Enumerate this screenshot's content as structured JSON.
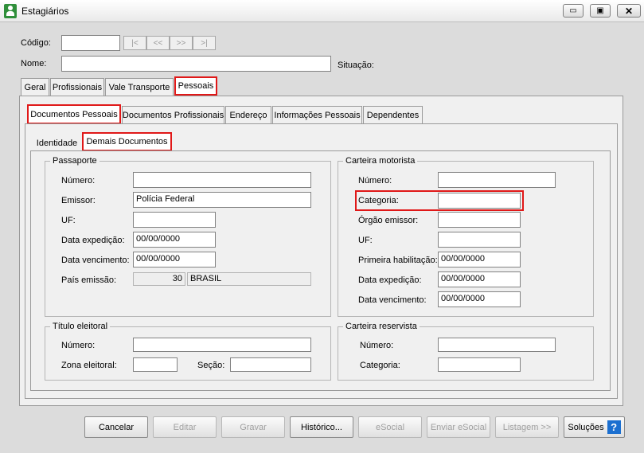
{
  "window": {
    "title": "Estagiários",
    "minimize": "▭",
    "maximize": "▣",
    "close": "✕"
  },
  "header": {
    "codigo_label": "Código:",
    "codigo_value": "",
    "nav": [
      "|<",
      "<<",
      ">>",
      ">|"
    ],
    "nome_label": "Nome:",
    "nome_value": "",
    "situacao_label": "Situação:"
  },
  "main_tabs": [
    "Geral",
    "Profissionais",
    "Vale Transporte",
    "Pessoais"
  ],
  "sub_tabs": [
    "Documentos Pessoais",
    "Documentos Profissionais",
    "Endereço",
    "Informações Pessoais",
    "Dependentes"
  ],
  "doc_tabs": [
    "Identidade",
    "Demais Documentos"
  ],
  "passaporte": {
    "legend": "Passaporte",
    "numero_label": "Número:",
    "numero": "",
    "emissor_label": "Emissor:",
    "emissor": "Polícia Federal",
    "uf_label": "UF:",
    "uf": "",
    "expedicao_label": "Data expedição:",
    "expedicao": "00/00/0000",
    "vencimento_label": "Data vencimento:",
    "vencimento": "00/00/0000",
    "pais_label": "País emissão:",
    "pais_codigo": "30",
    "pais_nome": "BRASIL"
  },
  "carteira_motorista": {
    "legend": "Carteira motorista",
    "numero_label": "Número:",
    "numero": "",
    "categoria_label": "Categoria:",
    "categoria": "",
    "orgao_label": "Órgão emissor:",
    "orgao": "",
    "uf_label": "UF:",
    "uf": "",
    "primeira_label": "Primeira habilitação:",
    "primeira": "00/00/0000",
    "expedicao_label": "Data expedição:",
    "expedicao": "00/00/0000",
    "vencimento_label": "Data vencimento:",
    "vencimento": "00/00/0000"
  },
  "titulo_eleitoral": {
    "legend": "Título eleitoral",
    "numero_label": "Número:",
    "numero": "",
    "zona_label": "Zona eleitoral:",
    "zona": "",
    "secao_label": "Seção:",
    "secao": ""
  },
  "carteira_reservista": {
    "legend": "Carteira reservista",
    "numero_label": "Número:",
    "numero": "",
    "categoria_label": "Categoria:",
    "categoria": ""
  },
  "buttons": {
    "cancelar": "Cancelar",
    "editar": "Editar",
    "gravar": "Gravar",
    "historico": "Histórico...",
    "esocial": "eSocial",
    "enviar_esocial": "Enviar eSocial",
    "listagem": "Listagem >>",
    "solucoes": "Soluções",
    "help": "?"
  },
  "colors": {
    "highlight": "#e01818",
    "app_icon": "#2f8f3a",
    "help_icon": "#1b6fd0"
  }
}
